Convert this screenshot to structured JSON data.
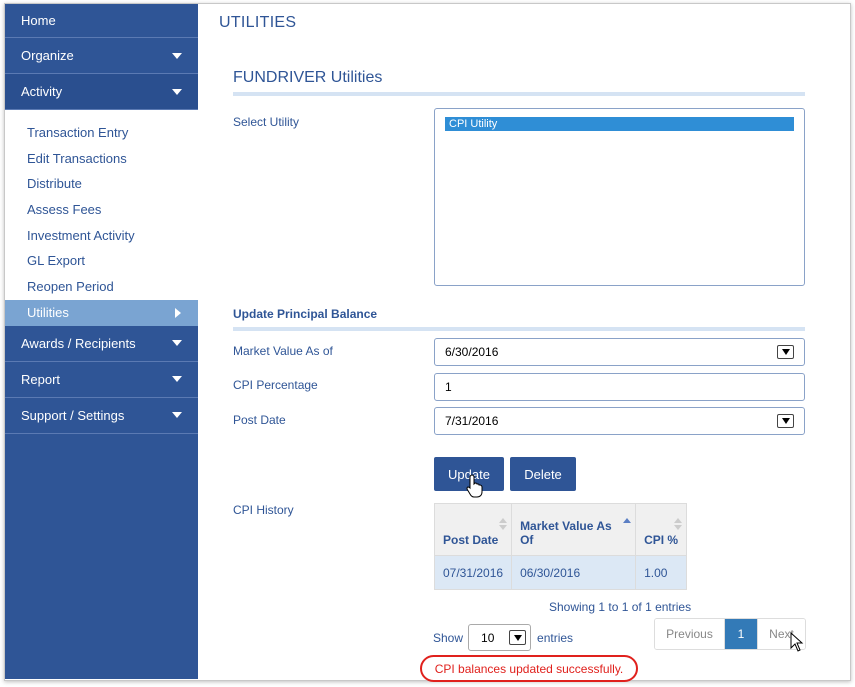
{
  "sidebar": {
    "home": "Home",
    "organize": "Organize",
    "activity": "Activity",
    "activity_items": [
      "Transaction Entry",
      "Edit Transactions",
      "Distribute",
      "Assess Fees",
      "Investment Activity",
      "GL Export",
      "Reopen Period",
      "Utilities"
    ],
    "awards": "Awards / Recipients",
    "report": "Report",
    "support": "Support / Settings"
  },
  "page": {
    "title": "UTILITIES",
    "section_title": "FUNDRIVER Utilities"
  },
  "form": {
    "select_utility_label": "Select Utility",
    "utility_options": [
      "CPI Utility"
    ],
    "update_section": "Update Principal Balance",
    "market_value_label": "Market Value As of",
    "market_value": "6/30/2016",
    "cpi_label": "CPI Percentage",
    "cpi_value": "1",
    "post_date_label": "Post Date",
    "post_date": "7/31/2016",
    "update_button": "Update",
    "delete_button": "Delete",
    "history_label": "CPI History"
  },
  "history_table": {
    "headers": [
      "Post Date",
      "Market Value As Of",
      "CPI %"
    ],
    "rows": [
      [
        "07/31/2016",
        "06/30/2016",
        "1.00"
      ]
    ],
    "info": "Showing 1 to 1 of 1 entries",
    "show_label": "Show",
    "page_length": "10",
    "entries_label": "entries",
    "previous": "Previous",
    "current_page": "1",
    "next": "Next"
  },
  "status": {
    "message": "CPI balances updated successfully.",
    "color": "#e0211d"
  },
  "colors": {
    "sidebar": "#2f5596",
    "selected_item": "#7aa4d2",
    "button": "#2f5596"
  }
}
